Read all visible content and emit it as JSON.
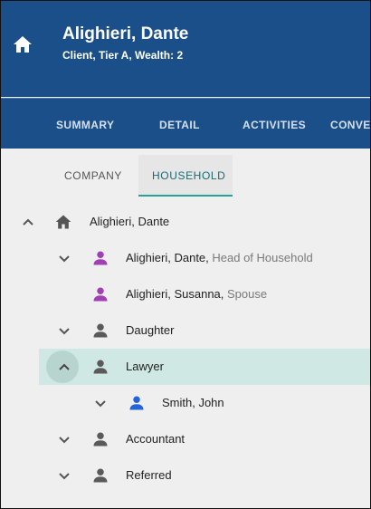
{
  "header": {
    "title": "Alighieri, Dante",
    "subtitle": "Client, Tier A, Wealth: 2",
    "home_icon": "home-icon"
  },
  "nav": {
    "tabs": [
      {
        "label": "SUMMARY"
      },
      {
        "label": "DETAIL"
      },
      {
        "label": "ACTIVITIES"
      },
      {
        "label": "CONVER"
      }
    ]
  },
  "subtabs": {
    "items": [
      {
        "label": "COMPANY"
      },
      {
        "label": "HOUSEHOLD",
        "active": true
      }
    ]
  },
  "tree": {
    "nodes": [
      {
        "name": "Alighieri, Dante",
        "role": "",
        "icon": "home-icon",
        "chevron": "up",
        "color": "#555555"
      },
      {
        "name": "Alighieri, Dante, ",
        "role": "Head of Household",
        "icon": "person-icon",
        "chevron": "down",
        "color": "#a23fb5"
      },
      {
        "name": "Alighieri, Susanna, ",
        "role": "Spouse",
        "icon": "person-icon",
        "chevron": "",
        "color": "#a23fb5"
      },
      {
        "name": "Daughter",
        "role": "",
        "icon": "person-icon",
        "chevron": "down",
        "color": "#5a5a5a"
      },
      {
        "name": "Lawyer",
        "role": "",
        "icon": "person-icon",
        "chevron": "up",
        "color": "#5a5a5a",
        "selected": true
      },
      {
        "name": "Smith, John",
        "role": "",
        "icon": "person-icon",
        "chevron": "down",
        "color": "#2563d9"
      },
      {
        "name": "Accountant",
        "role": "",
        "icon": "person-icon",
        "chevron": "down",
        "color": "#5a5a5a"
      },
      {
        "name": "Referred",
        "role": "",
        "icon": "person-icon",
        "chevron": "down",
        "color": "#5a5a5a"
      }
    ]
  },
  "colors": {
    "header_bg": "#1b4f8a",
    "accent": "#2aa198",
    "selected_bg": "#cfe8e3"
  }
}
